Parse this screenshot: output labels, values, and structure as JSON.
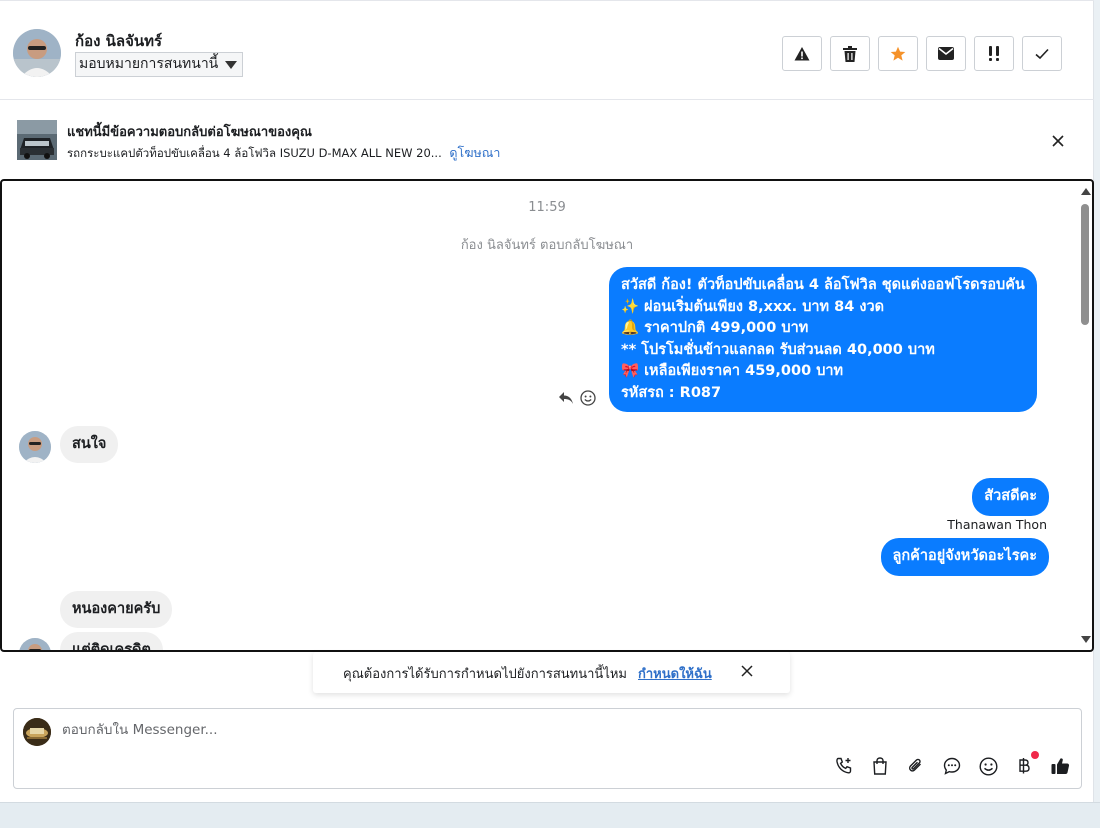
{
  "header": {
    "contact_name": "ก้อง นิลจันทร์",
    "assign_label": "มอบหมายการสนทนานี้",
    "buttons": [
      "alert-icon",
      "trash-icon",
      "star-icon",
      "envelope-icon",
      "double-exclamation-icon",
      "check-icon"
    ],
    "star_color": "#f5922a"
  },
  "ad_banner": {
    "title": "แชทนี้มีข้อความตอบกลับต่อโฆษณาของคุณ",
    "description": "รถกระบะแคปตัวท็อปขับเคลื่อน 4 ล้อโฟวิล ISUZU D-MAX ALL NEW 20...",
    "link": "ดูโฆษณา"
  },
  "chat": {
    "timestamp": "11:59",
    "system_message": "ก้อง นิลจันทร์ ตอบกลับโฆษณา",
    "messages": [
      {
        "direction": "out",
        "lines": [
          "สวัสดี ก้อง! ตัวท็อปขับเคลื่อน 4 ล้อโฟวิล ชุดแต่งออฟโรดรอบคัน",
          "✨  ผ่อนเริ่มต้นเพียง 8,xxx. บาท 84 งวด",
          "🔔 ราคาปกติ 499,000 บาท",
          "** โปรโมชั่นข้าวแลกลด รับส่วนลด 40,000 บาท",
          "🎀  เหลือเพียงราคา 459,000 บาท",
          " รหัสรถ : R087"
        ]
      },
      {
        "direction": "in",
        "text": "สนใจ"
      },
      {
        "direction": "out",
        "text": "สัวสดีคะ",
        "sender": "Thanawan Thon"
      },
      {
        "direction": "out",
        "text": "ลูกค้าอยู่จังหวัดอะไรคะ"
      },
      {
        "direction": "in",
        "text": "หนองคายครับ"
      },
      {
        "direction": "in",
        "text": "แต่ติดเครดิต"
      }
    ],
    "accent_color": "#0a7cff"
  },
  "toast": {
    "text": "คุณต้องการได้รับการกำหนดไปยังการสนทนานี้ไหม",
    "link": "กำหนดให้ฉัน"
  },
  "composer": {
    "placeholder": "ตอบกลับใน Messenger...",
    "tools": [
      "phone-plus-icon",
      "shopping-bag-icon",
      "paperclip-icon",
      "chat-bubble-icon",
      "emoji-icon",
      "baht-icon",
      "thumbs-up-icon"
    ]
  }
}
